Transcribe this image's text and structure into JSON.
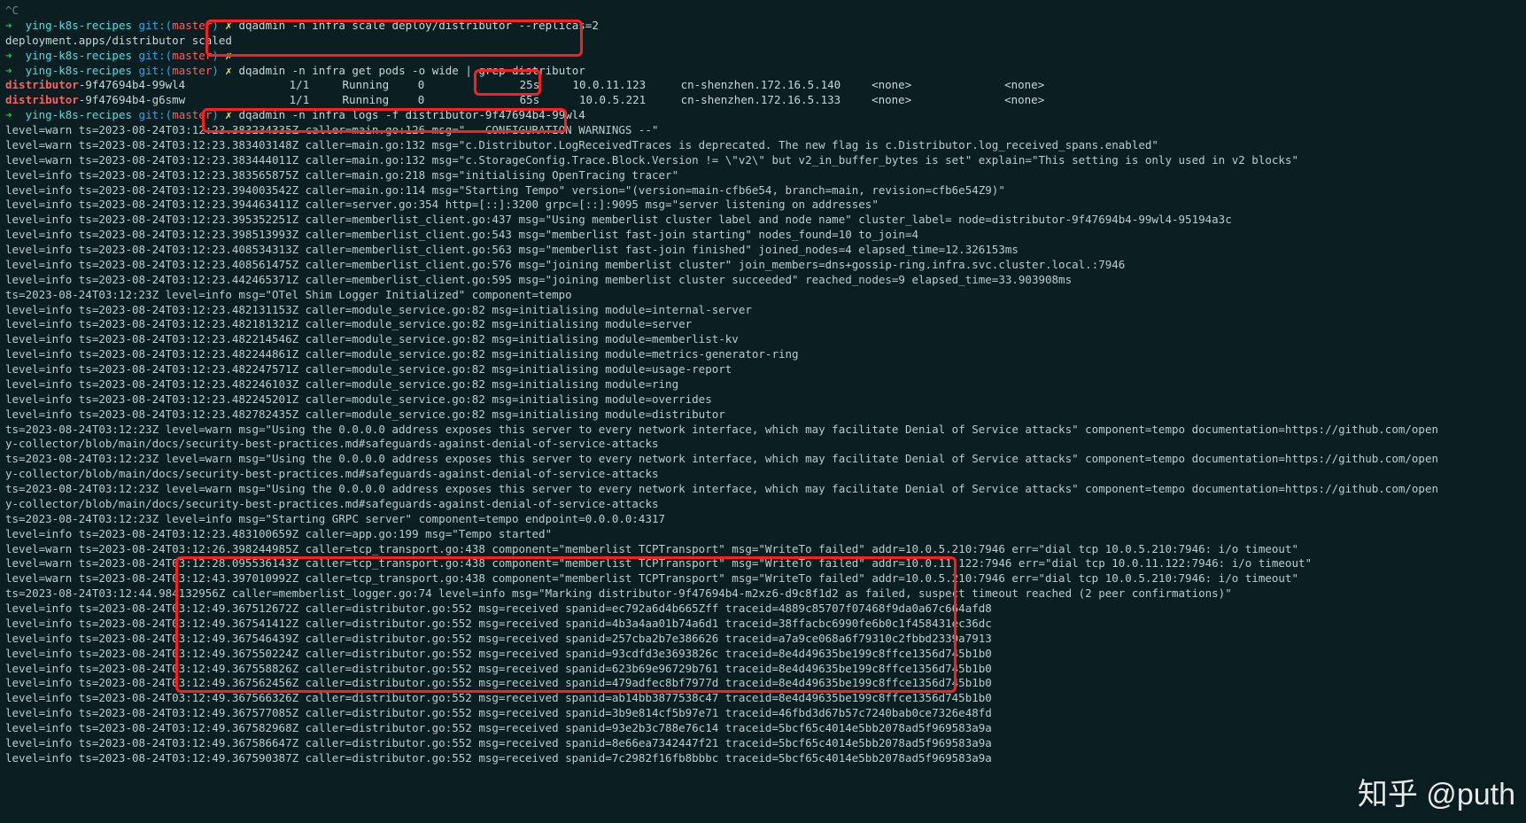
{
  "prompt": {
    "arrow": "➜",
    "dir": "ying-k8s-recipes",
    "gitword": "git:",
    "lparen": "(",
    "branch": "master",
    "rparen": ")",
    "dollar": "✗"
  },
  "top": {
    "ctrlc": "^C",
    "cmd1": "dqadmin -n infra scale deploy/distributor --replicas=2",
    "out1": "deployment.apps/distributor scaled",
    "cmd2": "dqadmin -n infra get pods -o wide | grep distributor"
  },
  "pods": [
    {
      "name": "distributor",
      "suffix": "-9f47694b4-99wl4",
      "ready": "1/1",
      "status": "Running",
      "restarts": "0",
      "age": "25s",
      "ip": "10.0.11.123",
      "node": "cn-shenzhen.172.16.5.140",
      "nom1": "<none>",
      "nom2": "<none>"
    },
    {
      "name": "distributor",
      "suffix": "-9f47694b4-g6smw",
      "ready": "1/1",
      "status": "Running",
      "restarts": "0",
      "age": "65s",
      "ip": "10.0.5.221",
      "node": "cn-shenzhen.172.16.5.133",
      "nom1": "<none>",
      "nom2": "<none>"
    }
  ],
  "cmd3": {
    "pre": "dqadmin -n infra logs ",
    "boxed": "-f distributor-9f47694b4-99wl4"
  },
  "logs": [
    "level=warn ts=2023-08-24T03:12:23.383234335Z caller=main.go:126 msg=\"-- CONFIGURATION WARNINGS --\"",
    "level=warn ts=2023-08-24T03:12:23.383403148Z caller=main.go:132 msg=\"c.Distributor.LogReceivedTraces is deprecated. The new flag is c.Distributor.log_received_spans.enabled\"",
    "level=warn ts=2023-08-24T03:12:23.383444011Z caller=main.go:132 msg=\"c.StorageConfig.Trace.Block.Version != \\\"v2\\\" but v2_in_buffer_bytes is set\" explain=\"This setting is only used in v2 blocks\"",
    "level=info ts=2023-08-24T03:12:23.383565875Z caller=main.go:218 msg=\"initialising OpenTracing tracer\"",
    "level=info ts=2023-08-24T03:12:23.394003542Z caller=main.go:114 msg=\"Starting Tempo\" version=\"(version=main-cfb6e54, branch=main, revision=cfb6e54Z9)\"",
    "level=info ts=2023-08-24T03:12:23.394463411Z caller=server.go:354 http=[::]:3200 grpc=[::]:9095 msg=\"server listening on addresses\"",
    "level=info ts=2023-08-24T03:12:23.395352251Z caller=memberlist_client.go:437 msg=\"Using memberlist cluster label and node name\" cluster_label= node=distributor-9f47694b4-99wl4-95194a3c",
    "level=info ts=2023-08-24T03:12:23.398513993Z caller=memberlist_client.go:543 msg=\"memberlist fast-join starting\" nodes_found=10 to_join=4",
    "level=info ts=2023-08-24T03:12:23.408534313Z caller=memberlist_client.go:563 msg=\"memberlist fast-join finished\" joined_nodes=4 elapsed_time=12.326153ms",
    "level=info ts=2023-08-24T03:12:23.408561475Z caller=memberlist_client.go:576 msg=\"joining memberlist cluster\" join_members=dns+gossip-ring.infra.svc.cluster.local.:7946",
    "level=info ts=2023-08-24T03:12:23.442465371Z caller=memberlist_client.go:595 msg=\"joining memberlist cluster succeeded\" reached_nodes=9 elapsed_time=33.903908ms",
    "ts=2023-08-24T03:12:23Z level=info msg=\"OTel Shim Logger Initialized\" component=tempo",
    "level=info ts=2023-08-24T03:12:23.482131153Z caller=module_service.go:82 msg=initialising module=internal-server",
    "level=info ts=2023-08-24T03:12:23.482181321Z caller=module_service.go:82 msg=initialising module=server",
    "level=info ts=2023-08-24T03:12:23.482214546Z caller=module_service.go:82 msg=initialising module=memberlist-kv",
    "level=info ts=2023-08-24T03:12:23.482244861Z caller=module_service.go:82 msg=initialising module=metrics-generator-ring",
    "level=info ts=2023-08-24T03:12:23.482247571Z caller=module_service.go:82 msg=initialising module=usage-report",
    "level=info ts=2023-08-24T03:12:23.482246103Z caller=module_service.go:82 msg=initialising module=ring",
    "level=info ts=2023-08-24T03:12:23.482245201Z caller=module_service.go:82 msg=initialising module=overrides",
    "level=info ts=2023-08-24T03:12:23.482782435Z caller=module_service.go:82 msg=initialising module=distributor",
    "ts=2023-08-24T03:12:23Z level=warn msg=\"Using the 0.0.0.0 address exposes this server to every network interface, which may facilitate Denial of Service attacks\" component=tempo documentation=https://github.com/open",
    "y-collector/blob/main/docs/security-best-practices.md#safeguards-against-denial-of-service-attacks",
    "ts=2023-08-24T03:12:23Z level=warn msg=\"Using the 0.0.0.0 address exposes this server to every network interface, which may facilitate Denial of Service attacks\" component=tempo documentation=https://github.com/open",
    "y-collector/blob/main/docs/security-best-practices.md#safeguards-against-denial-of-service-attacks",
    "ts=2023-08-24T03:12:23Z level=warn msg=\"Using the 0.0.0.0 address exposes this server to every network interface, which may facilitate Denial of Service attacks\" component=tempo documentation=https://github.com/open",
    "y-collector/blob/main/docs/security-best-practices.md#safeguards-against-denial-of-service-attacks",
    "ts=2023-08-24T03:12:23Z level=info msg=\"Starting GRPC server\" component=tempo endpoint=0.0.0.0:4317",
    "level=info ts=2023-08-24T03:12:23.483100659Z caller=app.go:199 msg=\"Tempo started\"",
    "level=warn ts=2023-08-24T03:12:26.398244985Z caller=tcp_transport.go:438 component=\"memberlist TCPTransport\" msg=\"WriteTo failed\" addr=10.0.5.210:7946 err=\"dial tcp 10.0.5.210:7946: i/o timeout\"",
    "level=warn ts=2023-08-24T03:12:28.095536143Z caller=tcp_transport.go:438 component=\"memberlist TCPTransport\" msg=\"WriteTo failed\" addr=10.0.11.122:7946 err=\"dial tcp 10.0.11.122:7946: i/o timeout\"",
    "level=warn ts=2023-08-24T03:12:43.397010992Z caller=tcp_transport.go:438 component=\"memberlist TCPTransport\" msg=\"WriteTo failed\" addr=10.0.5.210:7946 err=\"dial tcp 10.0.5.210:7946: i/o timeout\"",
    "ts=2023-08-24T03:12:44.984132956Z caller=memberlist_logger.go:74 level=info msg=\"Marking distributor-9f47694b4-m2xz6-d9c8f1d2 as failed, suspect timeout reached (2 peer confirmations)\"",
    "level=info ts=2023-08-24T03:12:49.367512672Z caller=distributor.go:552 msg=received spanid=ec792a6d4b665Zff traceid=4889c85707f07468f9da0a67c664afd8",
    "level=info ts=2023-08-24T03:12:49.367541412Z caller=distributor.go:552 msg=received spanid=4b3a4aa01b74a6d1 traceid=38ffacbc6990fe6b0c1f458431ec36dc",
    "level=info ts=2023-08-24T03:12:49.367546439Z caller=distributor.go:552 msg=received spanid=257cba2b7e386626 traceid=a7a9ce068a6f79310c2fbbd2339a7913",
    "level=info ts=2023-08-24T03:12:49.367550224Z caller=distributor.go:552 msg=received spanid=93cdfd3e3693826c traceid=8e4d49635be199c8ffce1356d745b1b0",
    "level=info ts=2023-08-24T03:12:49.367558826Z caller=distributor.go:552 msg=received spanid=623b69e96729b761 traceid=8e4d49635be199c8ffce1356d745b1b0",
    "level=info ts=2023-08-24T03:12:49.367562456Z caller=distributor.go:552 msg=received spanid=479adfec8bf7977d traceid=8e4d49635be199c8ffce1356d745b1b0",
    "level=info ts=2023-08-24T03:12:49.367566326Z caller=distributor.go:552 msg=received spanid=ab14bb3877538c47 traceid=8e4d49635be199c8ffce1356d745b1b0",
    "level=info ts=2023-08-24T03:12:49.367577085Z caller=distributor.go:552 msg=received spanid=3b9e814cf5b97e71 traceid=46fbd3d67b57c7240bab0ce7326e48fd",
    "level=info ts=2023-08-24T03:12:49.367582968Z caller=distributor.go:552 msg=received spanid=93e2b3c788e76c14 traceid=5bcf65c4014e5bb2078ad5f969583a9a",
    "level=info ts=2023-08-24T03:12:49.367586647Z caller=distributor.go:552 msg=received spanid=8e66ea7342447f21 traceid=5bcf65c4014e5bb2078ad5f969583a9a",
    "level=info ts=2023-08-24T03:12:49.367590387Z caller=distributor.go:552 msg=received spanid=7c2982f16fb8bbbc traceid=5bcf65c4014e5bb2078ad5f969583a9a"
  ],
  "watermark": "知乎 @puth"
}
